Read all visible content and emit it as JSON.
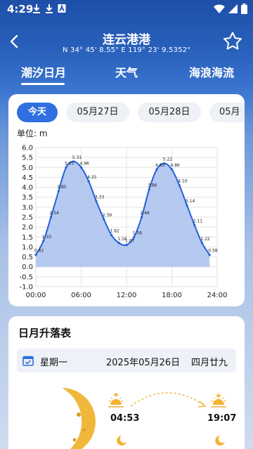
{
  "status": {
    "time": "4:29"
  },
  "header": {
    "title": "连云港港",
    "coords": "N 34° 45' 8.55\"  E 119° 23' 9.5352\""
  },
  "tabs": [
    {
      "label": "潮汐日月",
      "active": true
    },
    {
      "label": "天气"
    },
    {
      "label": "海浪海流"
    }
  ],
  "day_tabs": [
    "今天",
    "05月27日",
    "05月28日",
    "05月"
  ],
  "unit_label": "单位: m",
  "chart_data": {
    "type": "area",
    "ylim": [
      -1.0,
      6.0
    ],
    "yticks": [
      "6.0",
      "5.5",
      "5.0",
      "4.5",
      "4.0",
      "3.5",
      "3.0",
      "2.5",
      "2.0",
      "1.5",
      "1.0",
      "0.5",
      "0.0",
      "-0.5",
      "-1.0"
    ],
    "xticks": [
      "00:00",
      "06:00",
      "12:00",
      "18:00",
      "24:00"
    ],
    "points": [
      {
        "h": 0,
        "v": 0.6,
        "label": "0.62"
      },
      {
        "h": 1,
        "v": 1.3,
        "label": "1.33"
      },
      {
        "h": 2,
        "v": 2.5,
        "label": "2.54"
      },
      {
        "h": 3,
        "v": 3.8,
        "label": "3.85"
      },
      {
        "h": 4,
        "v": 5.0,
        "label": "5.05"
      },
      {
        "h": 5,
        "v": 5.3,
        "label": "5.31"
      },
      {
        "h": 6,
        "v": 5.0,
        "label": "4.96"
      },
      {
        "h": 7,
        "v": 4.3,
        "label": "4.25"
      },
      {
        "h": 8,
        "v": 3.3,
        "label": "3.33"
      },
      {
        "h": 9,
        "v": 2.4,
        "label": "2.39"
      },
      {
        "h": 10,
        "v": 1.6,
        "label": "1.62"
      },
      {
        "h": 11,
        "v": 1.2,
        "label": "1.16"
      },
      {
        "h": 12,
        "v": 1.1,
        "label": "1.07"
      },
      {
        "h": 13,
        "v": 1.5,
        "label": "1.56"
      },
      {
        "h": 14,
        "v": 2.5,
        "label": "2.46"
      },
      {
        "h": 15,
        "v": 3.9,
        "label": "3.86"
      },
      {
        "h": 16,
        "v": 4.9,
        "label": "4.85"
      },
      {
        "h": 17,
        "v": 5.2,
        "label": "5.22"
      },
      {
        "h": 18,
        "v": 4.9,
        "label": "4.86"
      },
      {
        "h": 19,
        "v": 4.1,
        "label": "4.10"
      },
      {
        "h": 20,
        "v": 3.1,
        "label": "3.14"
      },
      {
        "h": 21,
        "v": 2.1,
        "label": "2.11"
      },
      {
        "h": 22,
        "v": 1.2,
        "label": "1.22"
      },
      {
        "h": 23,
        "v": 0.6,
        "label": "0.58"
      }
    ],
    "colors": {
      "line": "#2361d6",
      "fill": "#a9c0ef"
    }
  },
  "sunmoon": {
    "title": "日月升落表",
    "weekday": "星期一",
    "date": "2025年05月26日",
    "lunar": "四月廿九",
    "sunrise": "04:53",
    "sunset": "19:07"
  },
  "colors": {
    "accent": "#2f6fe0",
    "sun": "#f2b233"
  }
}
